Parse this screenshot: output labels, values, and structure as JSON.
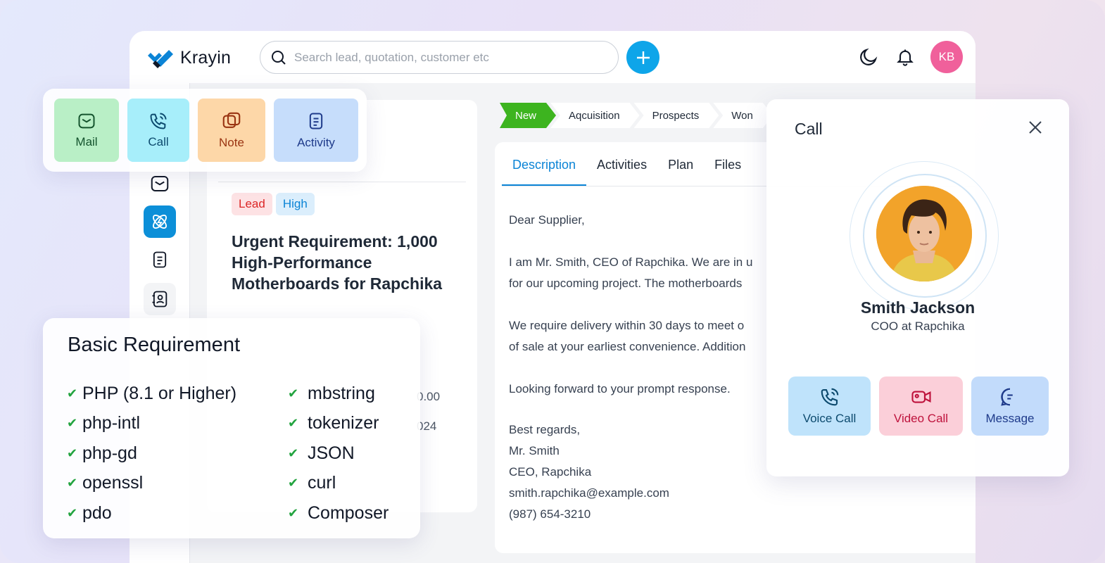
{
  "app": {
    "brand": "Krayin",
    "search_placeholder": "Search lead, quotation, customer etc",
    "user_initials": "KB"
  },
  "quick_actions": [
    {
      "label": "Mail",
      "icon": "mail-icon"
    },
    {
      "label": "Call",
      "icon": "phone-icon"
    },
    {
      "label": "Note",
      "icon": "note-icon"
    },
    {
      "label": "Activity",
      "icon": "activity-icon"
    }
  ],
  "lead": {
    "tags": [
      "Lead",
      "High"
    ],
    "title": "Urgent Requirement: 1,000 High-Performance Motherboards for Rapchika",
    "amount_partial": "0.00",
    "date_partial": "024"
  },
  "pipeline": {
    "stages": [
      "New",
      "Aqcuisition",
      "Prospects",
      "Won"
    ],
    "active": "New"
  },
  "description": {
    "tabs": [
      "Description",
      "Activities",
      "Plan",
      "Files"
    ],
    "active_tab": "Description",
    "greeting": "Dear Supplier,",
    "line1": "I am Mr. Smith, CEO of Rapchika. We are in u",
    "line2": "for our upcoming project. The motherboards",
    "line3": "We require delivery within 30 days to meet o",
    "line4": "of sale at your earliest convenience. Addition",
    "line5": "Looking forward to your prompt response.",
    "sign1": "Best regards,",
    "sign2": "Mr. Smith",
    "sign3": "CEO, Rapchika",
    "email": "smith.rapchika@example.com",
    "phone": "(987) 654-3210"
  },
  "requirements": {
    "title": "Basic Requirement",
    "left": [
      "PHP (8.1 or Higher)",
      "php-intl",
      "php-gd",
      "openssl",
      "pdo"
    ],
    "right": [
      "mbstring",
      "tokenizer",
      "JSON",
      "curl",
      "Composer"
    ]
  },
  "call": {
    "title": "Call",
    "name": "Smith Jackson",
    "role": "COO at Rapchika",
    "buttons": [
      "Voice Call",
      "Video Call",
      "Message"
    ]
  },
  "colors": {
    "accent": "#0ea5e9",
    "pipeline_active": "#3db41f",
    "avatar_bg": "#f0609b"
  }
}
